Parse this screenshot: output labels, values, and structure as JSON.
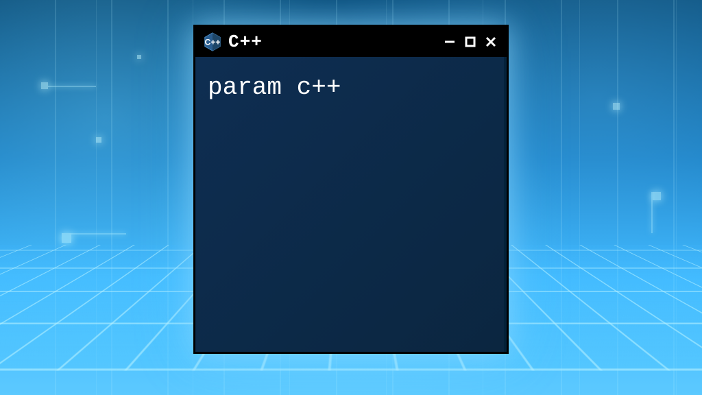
{
  "window": {
    "title": "C++",
    "icon_name": "cpp-logo"
  },
  "terminal": {
    "content": "param c++"
  },
  "colors": {
    "terminal_bg": "#0d2b4a",
    "titlebar_bg": "#000000",
    "text": "#ffffff",
    "glow": "#7edfff"
  }
}
